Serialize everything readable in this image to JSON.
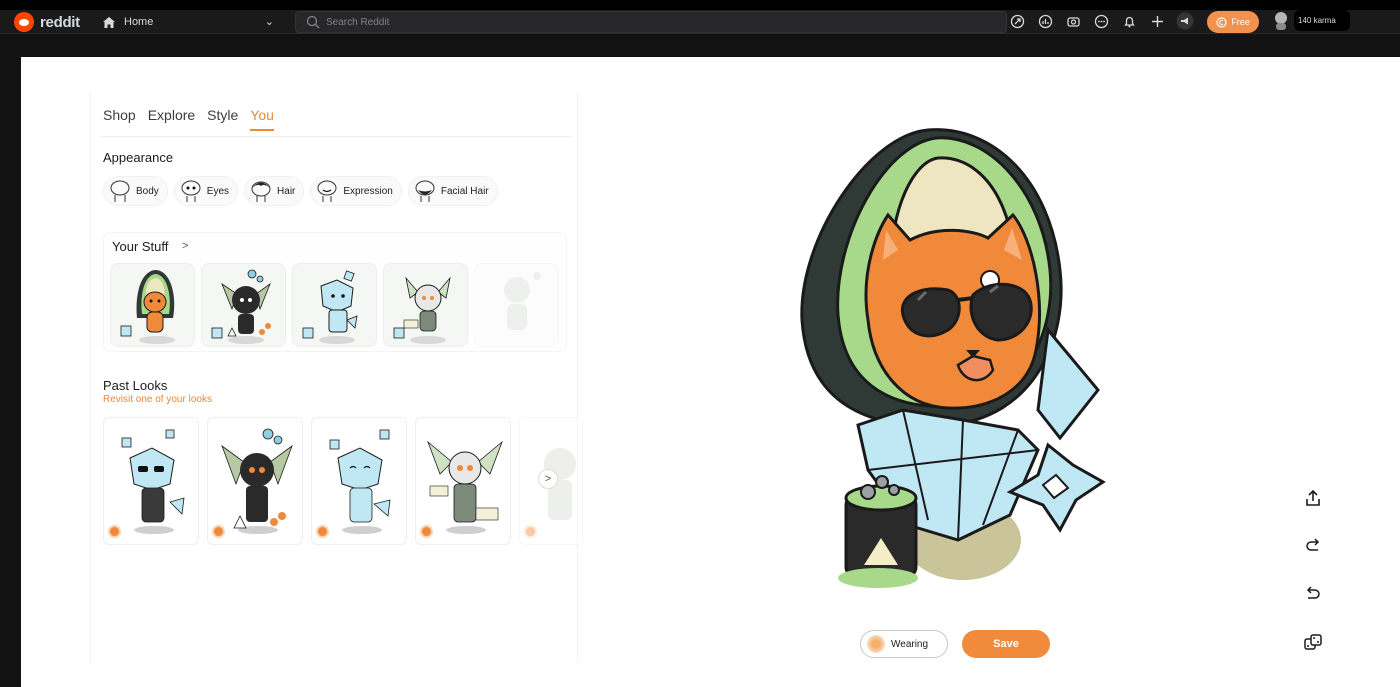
{
  "topbar": {
    "brand": "reddit",
    "home_label": "Home",
    "search_placeholder": "Search Reddit",
    "icons": [
      "popular-icon",
      "stats-icon",
      "coins-icon",
      "chat-icon",
      "bell-icon",
      "plus-icon",
      "advertise-icon"
    ],
    "free_label": "Free",
    "karma": "140 karma"
  },
  "left": {
    "tabs": [
      {
        "label": "Shop"
      },
      {
        "label": "Explore"
      },
      {
        "label": "Style"
      },
      {
        "label": "You",
        "active": true
      }
    ],
    "appearance_title": "Appearance",
    "appearance_chips": [
      {
        "label": "Body"
      },
      {
        "label": "Eyes"
      },
      {
        "label": "Hair"
      },
      {
        "label": "Expression"
      },
      {
        "label": "Facial Hair"
      }
    ],
    "your_stuff_title": "Your Stuff",
    "past_looks_title": "Past Looks",
    "past_looks_subtitle": "Revisit one of your looks"
  },
  "bottom": {
    "wearing_label": "Wearing",
    "save_label": "Save"
  },
  "colors": {
    "accent": "#f18b3c",
    "brand": "#ff4500",
    "avatar_orange": "#f08a3a",
    "egg_green": "#a8d98a",
    "crystal_blue": "#bfe8f4"
  }
}
